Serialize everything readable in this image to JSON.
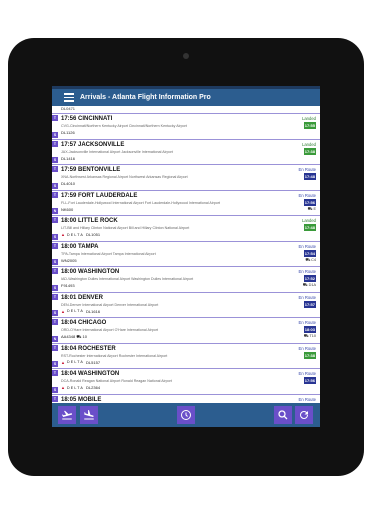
{
  "app": {
    "title": "Arrivals - Atlanta Flight Information Pro"
  },
  "partial_top": {
    "flight": "DL0471"
  },
  "flights": [
    {
      "time_city": "17:56 CINCINNATI",
      "route": "CVG-Cincinnati/Northern Kentucky Airport Cincinnati/Northern Kentucky Airport",
      "flight": "DL1126",
      "terminal": "",
      "gate": "S",
      "status": "Landed",
      "status_class": "landed",
      "arr_time": "17:55",
      "time_class": "green",
      "baggage": "",
      "airline": ""
    },
    {
      "time_city": "17:57 JACKSONVILLE",
      "route": "JAX-Jacksonville International Airport Jacksonville International Airport",
      "flight": "DL1416",
      "terminal": "",
      "gate": "S",
      "status": "Landed",
      "status_class": "landed",
      "arr_time": "17:38",
      "time_class": "green",
      "baggage": "",
      "airline": ""
    },
    {
      "time_city": "17:59 BENTONVILLE",
      "route": "XNA-Northwest Arkansas Regional Airport Northwest Arkansas Regional Airport",
      "flight": "DL4010",
      "terminal": "",
      "gate": "S",
      "status": "En Route",
      "status_class": "enroute",
      "arr_time": "17:48",
      "time_class": "blue",
      "baggage": "",
      "airline": ""
    },
    {
      "time_city": "17:59 FORT LAUDERDALE",
      "route": "FLL-Fort Lauderdale-Hollywood International Airport Fort Lauderdale-Hollywood International Airport",
      "flight": "NK600",
      "terminal": "",
      "gate": "N",
      "status": "En Route",
      "status_class": "enroute",
      "arr_time": "17:56",
      "time_class": "blue",
      "baggage": "⛟ E",
      "airline": ""
    },
    {
      "time_city": "18:00 LITTLE ROCK",
      "route": "LIT-Bill and Hillary Clinton National Airport Bill and Hillary Clinton National Airport",
      "flight": "DL1051",
      "terminal": "",
      "gate": "S",
      "status": "Landed",
      "status_class": "landed",
      "arr_time": "17:48",
      "time_class": "green",
      "baggage": "",
      "airline": "DELTA"
    },
    {
      "time_city": "18:00 TAMPA",
      "route": "TPA-Tampa International Airport Tampa International Airport",
      "flight": "WN2005",
      "terminal": "",
      "gate": "S",
      "status": "En Route",
      "status_class": "enroute",
      "arr_time": "17:54",
      "time_class": "blue",
      "baggage": "⛟ C4",
      "airline": ""
    },
    {
      "time_city": "18:00 WASHINGTON",
      "route": "IAD-Washington Dulles International Airport Washington Dulles International Airport",
      "flight": "F91493",
      "terminal": "",
      "gate": "S",
      "status": "En Route",
      "status_class": "enroute",
      "arr_time": "17:52",
      "time_class": "blue",
      "baggage": "⛟ D1A",
      "airline": ""
    },
    {
      "time_city": "18:01 DENVER",
      "route": "DEN-Denver International Airport Denver International Airport",
      "flight": "DL1616",
      "terminal": "",
      "gate": "S",
      "status": "En Route",
      "status_class": "enroute",
      "arr_time": "17:57",
      "time_class": "blue",
      "baggage": "",
      "airline": "DELTA"
    },
    {
      "time_city": "18:04 CHICAGO",
      "route": "ORD-O'Hare International Airport O'Hare International Airport",
      "flight": "AA4348   ⛟ 10",
      "terminal": "",
      "gate": "N",
      "status": "En Route",
      "status_class": "enroute",
      "arr_time": "18:03",
      "time_class": "blue",
      "baggage": "⛟ T10",
      "airline": ""
    },
    {
      "time_city": "18:04 ROCHESTER",
      "route": "RST-Rochester International Airport Rochester International Airport",
      "flight": "DL5157",
      "terminal": "",
      "gate": "S",
      "status": "En Route",
      "status_class": "enroute",
      "arr_time": "17:38",
      "time_class": "green",
      "baggage": "",
      "airline": "DELTA"
    },
    {
      "time_city": "18:04 WASHINGTON",
      "route": "DCA-Ronald Reagan National Airport Ronald Reagan National Airport",
      "flight": "DL2364",
      "terminal": "",
      "gate": "S",
      "status": "En Route",
      "status_class": "enroute",
      "arr_time": "17:56",
      "time_class": "blue",
      "baggage": "",
      "airline": "DELTA"
    },
    {
      "time_city": "18:05 MOBILE",
      "route": "MOB-Mobile Regional Airport Mobile Regional Airport",
      "flight": "",
      "terminal": "",
      "gate": "",
      "status": "En Route",
      "status_class": "enroute",
      "arr_time": "",
      "time_class": "blue",
      "baggage": "",
      "airline": ""
    }
  ],
  "bottom": {
    "icons": [
      "departures-icon",
      "arrivals-icon",
      "clock-icon",
      "search-icon",
      "refresh-icon"
    ]
  },
  "colors": {
    "appbar": "#2c5d8f",
    "accent": "#6a4fc9",
    "landed": "#2e7d32",
    "enroute": "#3949ab"
  }
}
